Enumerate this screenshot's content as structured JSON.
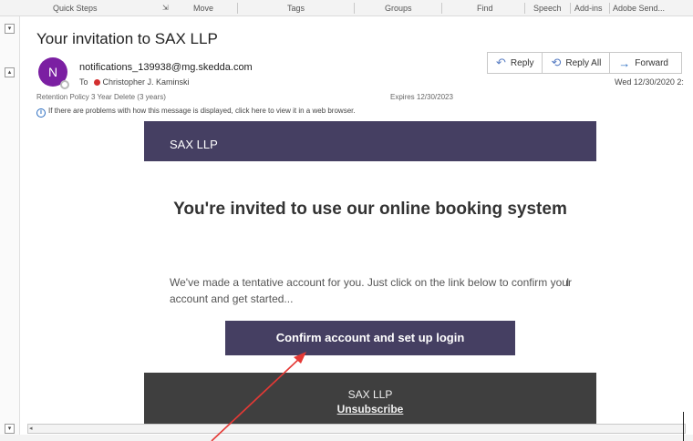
{
  "ribbon": {
    "groups": [
      "Quick Steps",
      "Move",
      "Tags",
      "Groups",
      "Find",
      "Speech",
      "Add-ins",
      "Adobe Send..."
    ]
  },
  "message": {
    "subject": "Your invitation to SAX LLP",
    "avatar_letter": "N",
    "sender": "notifications_139938@mg.skedda.com",
    "to_label": "To",
    "recipient": "Christopher J. Kaminski",
    "date": "Wed 12/30/2020 2:",
    "retention": "Retention Policy  3 Year Delete (3 years)",
    "expires": "Expires  12/30/2023",
    "info": "If there are problems with how this message is displayed, click here to view it in a web browser."
  },
  "actions": {
    "reply": "Reply",
    "reply_all": "Reply All",
    "forward": "Forward"
  },
  "email": {
    "brand": "SAX LLP",
    "headline": "You're invited to use our online booking system",
    "body": "We've made a tentative account for you. Just click on the link below to confirm your account and get started...",
    "cta": "Confirm account and set up login",
    "footer_brand": "SAX LLP",
    "unsubscribe": "Unsubscribe"
  },
  "colors": {
    "brand": "#453f62",
    "footer": "#3f3f3f",
    "avatar": "#7b1fa2",
    "annotation_arrow": "#e53935"
  }
}
